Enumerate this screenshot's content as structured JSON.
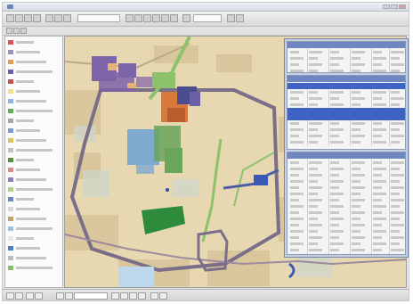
{
  "window": {
    "title": ""
  },
  "toolbar": {
    "scale_value": "",
    "layer_dropdown_value": ""
  },
  "toc": {
    "layers": [
      {
        "swatch": "#d9534f"
      },
      {
        "swatch": "#9b8fc3"
      },
      {
        "swatch": "#e39d57"
      },
      {
        "swatch": "#6c5fa8"
      },
      {
        "swatch": "#c24f4f"
      },
      {
        "swatch": "#efe08a"
      },
      {
        "swatch": "#8fb6d8"
      },
      {
        "swatch": "#66a95d"
      },
      {
        "swatch": "#a7a7a7"
      },
      {
        "swatch": "#7b9bd1"
      },
      {
        "swatch": "#e0c35c"
      },
      {
        "swatch": "#c3c3c3"
      },
      {
        "swatch": "#5b8f3f"
      },
      {
        "swatch": "#d98a8a"
      },
      {
        "swatch": "#8b7fb6"
      },
      {
        "swatch": "#b2d38c"
      },
      {
        "swatch": "#6f86bf"
      },
      {
        "swatch": "#d9d9d9"
      },
      {
        "swatch": "#c5a46b"
      },
      {
        "swatch": "#9cc2e0"
      },
      {
        "swatch": "#e6e6e6"
      },
      {
        "swatch": "#4e7fc2"
      },
      {
        "swatch": "#bcbcbc"
      },
      {
        "swatch": "#8cbf6a"
      }
    ]
  },
  "map": {
    "colors": {
      "background": "#e8d8b2",
      "urban": "#d8c59a",
      "parcels_purple": "#7d63a8",
      "parcels_orange": "#d87a3b",
      "parcels_blue": "#7fa9cf",
      "parcels_green": "#6aa55a",
      "park": "#2f8b3c",
      "road_primary": "#7a6e88",
      "road_green": "#8cc26b",
      "highlight_blue": "#3a58b7"
    }
  },
  "attribute_tables": {
    "header_color": "#6f86bf",
    "selected_row_color": "#3f63c3",
    "panels": [
      {
        "id": "top"
      },
      {
        "id": "middle"
      },
      {
        "id": "bottom"
      }
    ]
  },
  "statusbar": {
    "coordinates": ""
  }
}
